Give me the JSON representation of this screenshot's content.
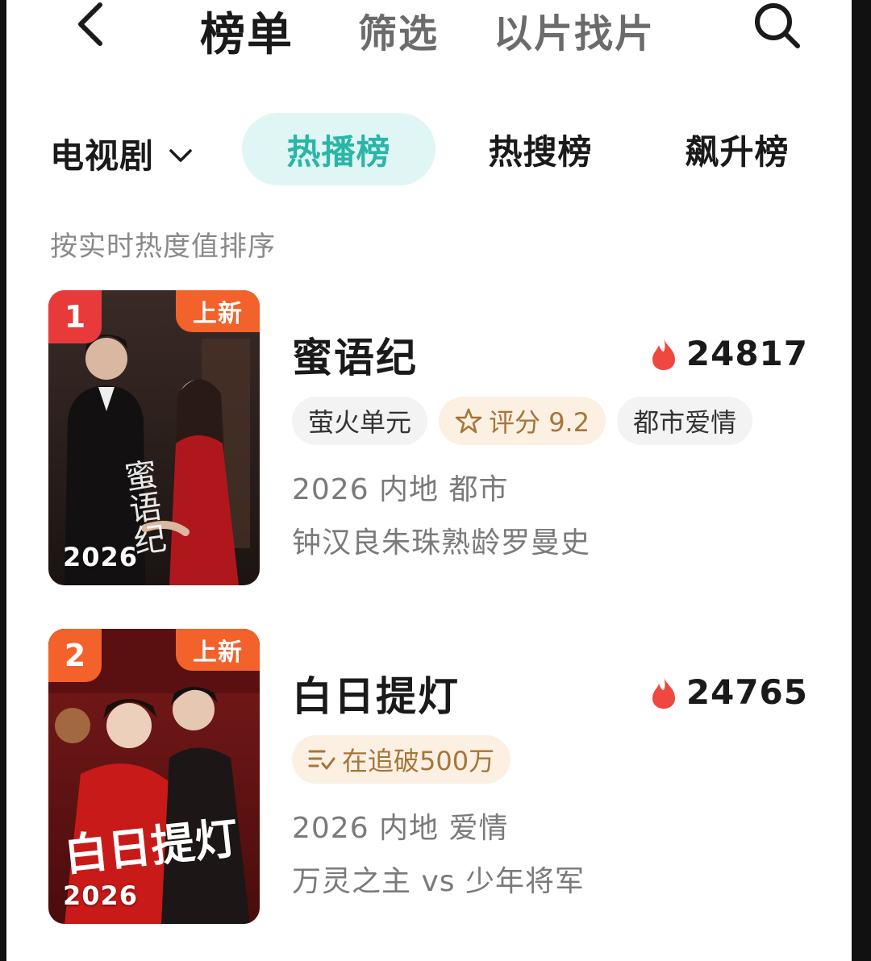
{
  "nav": {
    "tabs": [
      "榜单",
      "筛选",
      "以片找片"
    ]
  },
  "category": {
    "selected": "电视剧",
    "rank_tabs": [
      "热播榜",
      "热搜榜",
      "飙升榜"
    ]
  },
  "sort_hint": "按实时热度值排序",
  "items": [
    {
      "rank": "1",
      "badge": "上新",
      "poster_year": "2026",
      "poster_title": "蜜语纪",
      "title": "蜜语纪",
      "heat": "24817",
      "tags": [
        "萤火单元",
        "评分 9.2",
        "都市爱情"
      ],
      "meta_line": "2026 内地 都市",
      "desc": "钟汉良朱珠熟龄罗曼史"
    },
    {
      "rank": "2",
      "badge": "上新",
      "poster_year": "2026",
      "poster_title": "白日提灯",
      "title": "白日提灯",
      "heat": "24765",
      "tags": [
        "在追破500万"
      ],
      "meta_line": "2026 内地 爱情",
      "desc": "万灵之主 vs 少年将军"
    }
  ],
  "colors": {
    "accent": "#29b6a8",
    "accent_bg": "#e0f6f4",
    "rank1": "#e83a3a",
    "rank2": "#f2622a",
    "flame": "#f0483e",
    "gold_text": "#a6763a",
    "gold_bg": "#fbf0e2"
  },
  "icons": {
    "back": "chevron-left-icon",
    "search": "search-icon",
    "dropdown": "chevron-down-icon",
    "heat": "flame-icon",
    "rating": "star-icon",
    "following": "list-check-icon"
  }
}
